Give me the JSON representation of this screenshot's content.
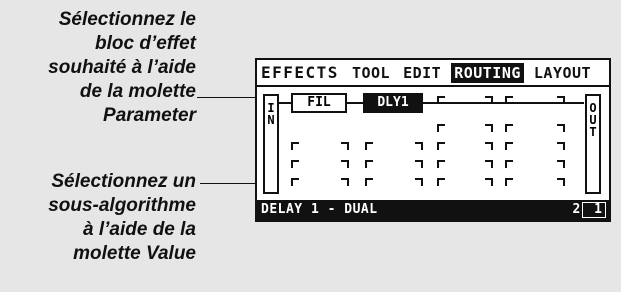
{
  "annotations": {
    "top": "Sélectionnez le\nbloc d’effet\nsouhaité à l’aide\nde la molette\nParameter",
    "bottom": "Sélectionnez un\nsous-algorithme\nà l’aide de la\nmolette Value"
  },
  "lcd": {
    "tabs": [
      {
        "label": "EFFECTS"
      },
      {
        "label": "TOOL"
      },
      {
        "label": "EDIT"
      },
      {
        "label": "ROUTING"
      },
      {
        "label": "LAYOUT"
      }
    ],
    "active_tab": "ROUTING",
    "routing": {
      "input_label": "IN",
      "output_label": "OUT",
      "blocks": [
        {
          "label": "FIL",
          "selected": false
        },
        {
          "label": "DLY1",
          "selected": true
        }
      ]
    },
    "status": {
      "name": "DELAY 1 - DUAL",
      "value": "2 1"
    }
  },
  "colors": {
    "background": "#e6e6e6",
    "lcd": "#ffffff",
    "ink": "#111111"
  }
}
